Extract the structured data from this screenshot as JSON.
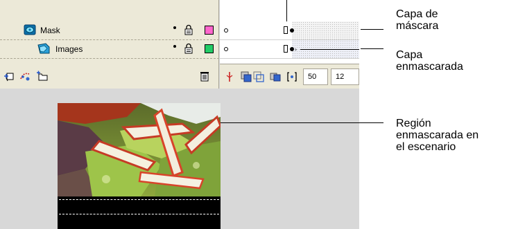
{
  "layers": [
    {
      "name": "Mask",
      "swatch": "#ff66cc"
    },
    {
      "name": "Images",
      "swatch": "#22cc66"
    }
  ],
  "timeline": {
    "frame_number": "50",
    "frame_rate": "12"
  },
  "callouts": {
    "mask_layer": "Capa de\nmáscara",
    "masked_layer": "Capa\nenmascarada",
    "masked_region": "Región\nenmascarada en\nel escenario"
  },
  "icons": {
    "mask_layer": "mask-layer-icon",
    "masked_layer": "masked-layer-icon",
    "lock": "lock-icon",
    "insert_layer": "insert-layer-icon",
    "motion_guide": "add-motion-guide-icon",
    "insert_folder": "insert-layer-folder-icon",
    "delete": "trash-icon",
    "center_frame": "center-frame-icon",
    "onion_skin": "onion-skin-icon",
    "onion_outlines": "onion-skin-outlines-icon",
    "edit_multiple": "edit-multiple-frames-icon",
    "onion_markers": "modify-onion-markers-icon"
  }
}
